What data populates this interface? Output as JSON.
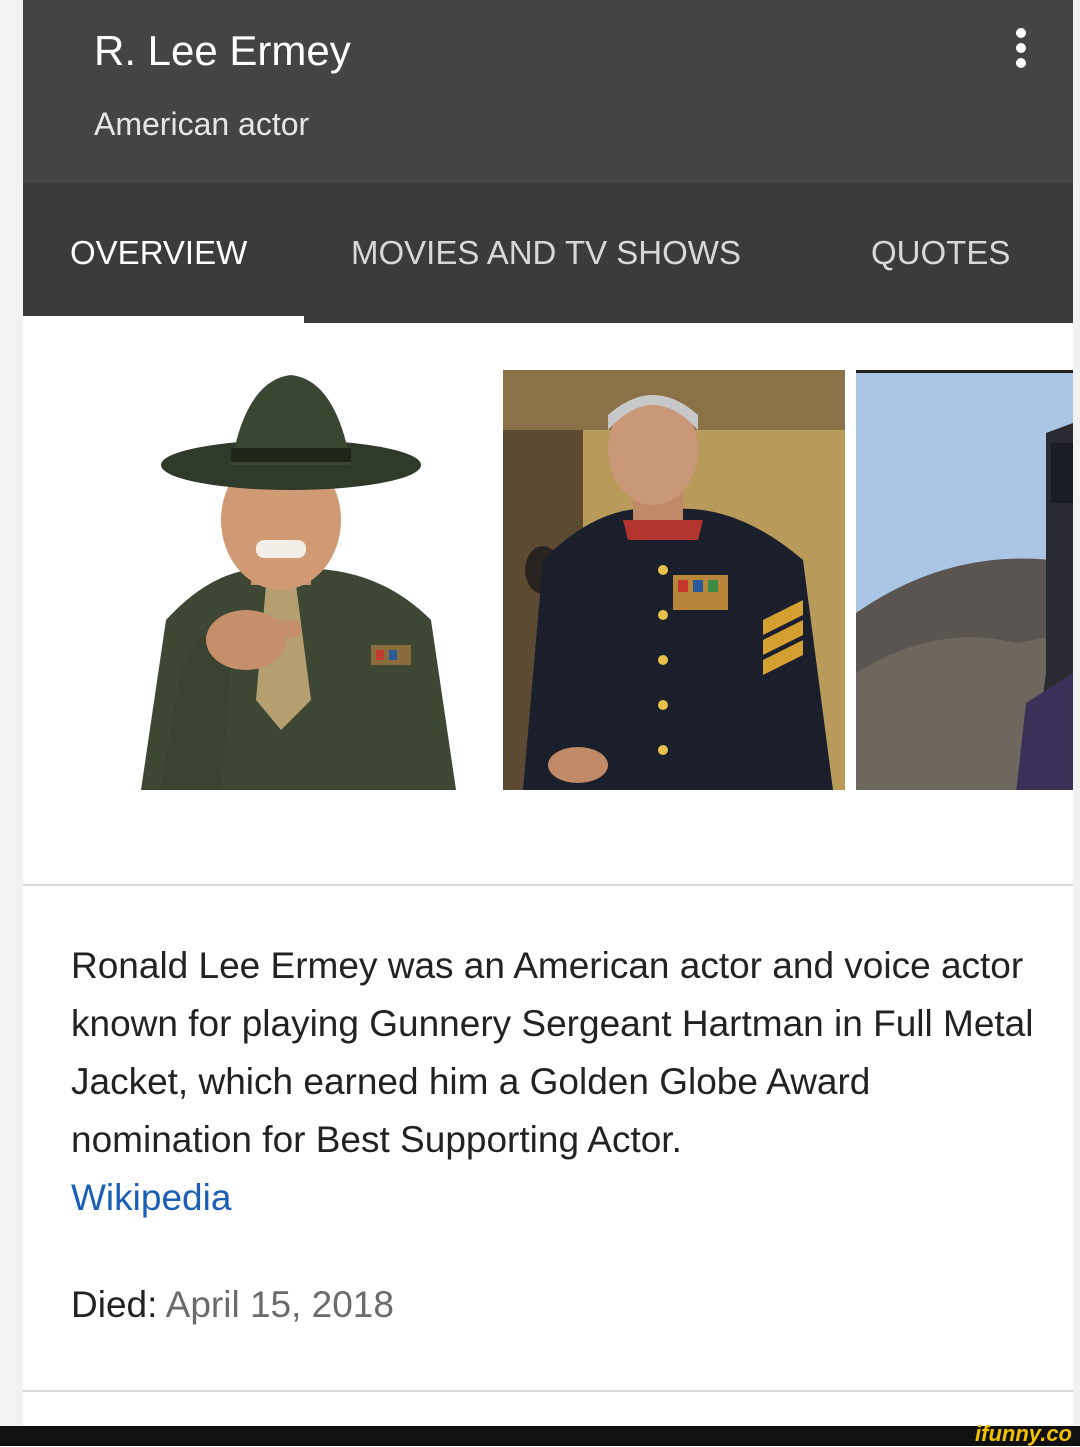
{
  "header": {
    "title": "R. Lee Ermey",
    "subtitle": "American actor"
  },
  "tabs": [
    {
      "label": "OVERVIEW",
      "active": true
    },
    {
      "label": "MOVIES AND TV SHOWS",
      "active": false
    },
    {
      "label": "QUOTES",
      "active": false
    }
  ],
  "images": [
    {
      "icon": "drill-instructor-photo"
    },
    {
      "icon": "dress-uniform-photo"
    },
    {
      "icon": "film-still-photo"
    }
  ],
  "description": {
    "text": "Ronald Lee Ermey was an American actor and voice actor known for playing Gunnery Sergeant Hartman in Full Metal Jacket, which earned him a Golden Globe Award nomination for Best Supporting Actor.",
    "source_link": "Wikipedia"
  },
  "facts": {
    "died_label": "Died:",
    "died_value": "April 15, 2018"
  },
  "watermark": "ifunny.co",
  "colors": {
    "header_bg": "#444444",
    "tabs_bg": "#3b3b3b",
    "link": "#1a5fb4"
  }
}
